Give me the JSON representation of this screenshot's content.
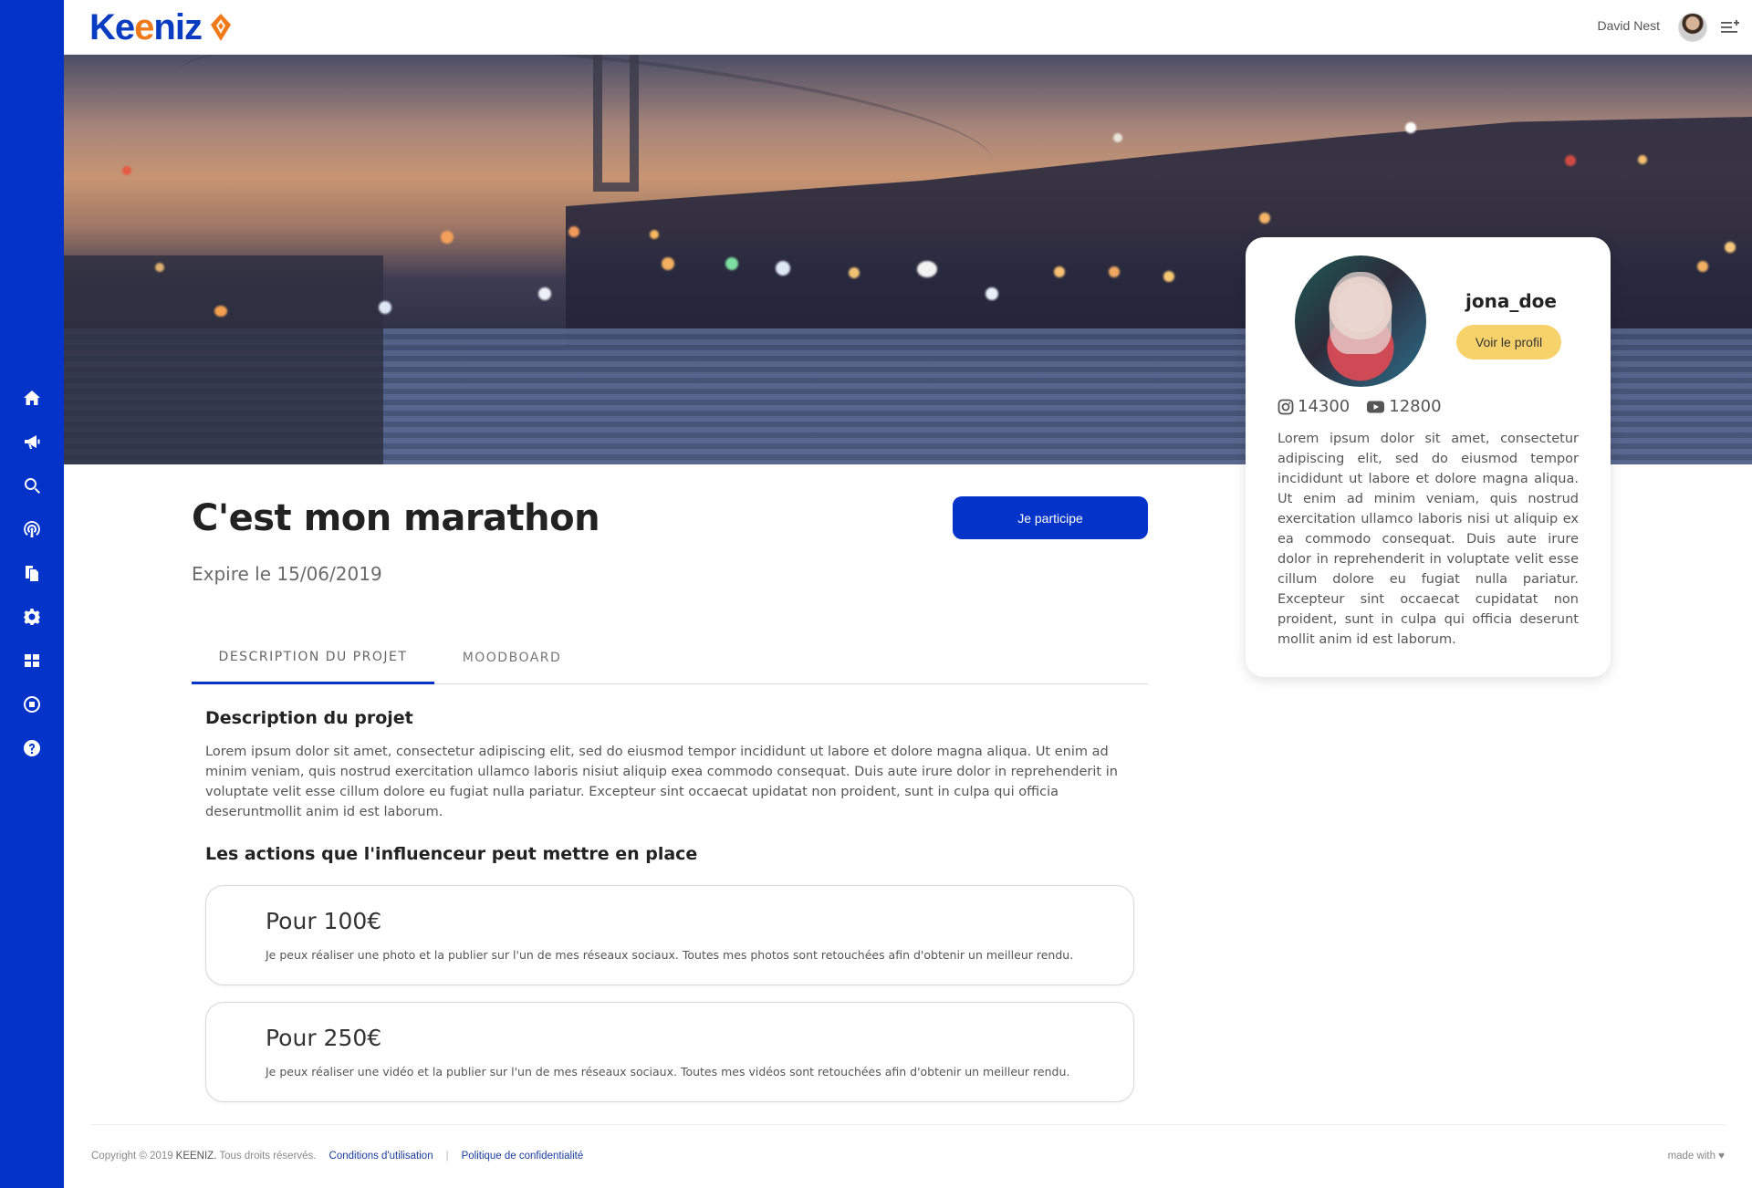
{
  "sidebar": {
    "items": [
      {
        "icon": "home-icon"
      },
      {
        "icon": "megaphone-icon"
      },
      {
        "icon": "search-icon"
      },
      {
        "icon": "broadcast-icon"
      },
      {
        "icon": "documents-icon"
      },
      {
        "icon": "gear-icon"
      },
      {
        "icon": "dashboard-icon"
      },
      {
        "icon": "record-icon"
      },
      {
        "icon": "help-icon"
      }
    ],
    "color": "#0433c9"
  },
  "header": {
    "logo_prefix": "Ke",
    "logo_o": "e",
    "logo_suffix": "niz",
    "user_name": "David Nest"
  },
  "profile": {
    "username": "jona_doe",
    "view_profile_label": "Voir le profil",
    "instagram_count": "14300",
    "youtube_count": "12800",
    "bio": "Lorem ipsum dolor sit amet, consectetur adipiscing elit, sed do eiusmod tempor incididunt ut labore et dolore magna aliqua. Ut enim ad minim veniam, quis nostrud exercitation ullamco laboris nisi ut aliquip ex ea commodo consequat. Duis aute irure dolor in reprehenderit in voluptate velit esse cillum dolore eu fugiat nulla pariatur. Excepteur sint occaecat cupidatat non proident, sunt in culpa qui officia deserunt mollit anim id est laborum."
  },
  "project": {
    "title": "C'est mon marathon",
    "expire": "Expire le 15/06/2019",
    "participate_label": "Je participe"
  },
  "tabs": [
    {
      "label": "DESCRIPTION DU PROJET",
      "active": true
    },
    {
      "label": "MOODBOARD",
      "active": false
    }
  ],
  "description": {
    "title": "Description du projet",
    "text": "Lorem ipsum dolor sit amet, consectetur adipiscing elit, sed do eiusmod tempor incididunt ut labore et dolore magna aliqua. Ut enim ad minim veniam, quis nostrud exercitation ullamco laboris nisiut aliquip exea commodo consequat. Duis aute irure dolor in reprehenderit in voluptate velit esse cillum dolore eu fugiat nulla pariatur. Excepteur sint occaecat upidatat non proident, sunt in culpa qui officia deseruntmollit anim id est laborum."
  },
  "actions": {
    "title": "Les actions que l'influenceur peut mettre en place",
    "items": [
      {
        "price": "Pour 100€",
        "text": "Je peux réaliser une photo et la publier sur l'un de mes réseaux sociaux. Toutes mes photos sont retouchées afin d'obtenir un meilleur rendu."
      },
      {
        "price": "Pour 250€",
        "text": "Je peux réaliser une vidéo et la publier sur l'un de mes réseaux sociaux. Toutes mes vidéos sont retouchées afin d'obtenir un meilleur rendu."
      }
    ]
  },
  "footer": {
    "copyright": "Copyright © 2019",
    "brand": "KEENIZ.",
    "rights": "Tous droits réservés.",
    "terms_link": "Conditions d'utilisation",
    "separator": "|",
    "privacy_link": "Politique de confidentialité",
    "made_with": "made with ♥"
  },
  "colors": {
    "primary": "#0433c9",
    "accent_orange": "#f07a1a",
    "profile_button": "#f7d26a"
  }
}
